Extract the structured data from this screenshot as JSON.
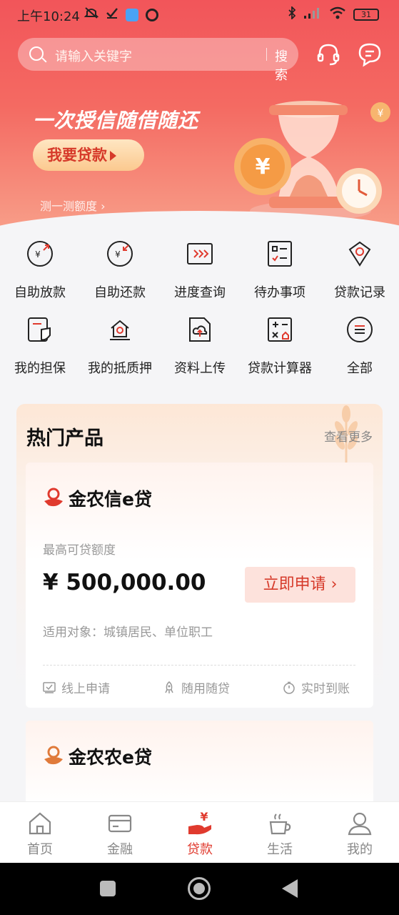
{
  "status_bar": {
    "time": "上午10:24",
    "battery": "31"
  },
  "search": {
    "placeholder": "请输入关键字",
    "button": "搜索"
  },
  "banner": {
    "title": "一次授信随借随还",
    "button": "我要贷款",
    "sub_link": "测一测额度 ›"
  },
  "features": [
    {
      "label": "自助放款",
      "icon": "self-lend-icon"
    },
    {
      "label": "自助还款",
      "icon": "self-repay-icon"
    },
    {
      "label": "进度查询",
      "icon": "progress-icon"
    },
    {
      "label": "待办事项",
      "icon": "todo-icon"
    },
    {
      "label": "贷款记录",
      "icon": "loan-record-icon"
    },
    {
      "label": "我的担保",
      "icon": "guarantee-icon"
    },
    {
      "label": "我的抵质押",
      "icon": "mortgage-icon"
    },
    {
      "label": "资料上传",
      "icon": "upload-icon"
    },
    {
      "label": "贷款计算器",
      "icon": "calculator-icon"
    },
    {
      "label": "全部",
      "icon": "all-menu-icon"
    }
  ],
  "hot_products": {
    "title": "热门产品",
    "more": "查看更多",
    "cards": [
      {
        "name": "金农信e贷",
        "limit_label": "最高可贷额度",
        "amount": "¥ 500,000.00",
        "apply": "立即申请 ›",
        "target": "适用对象：城镇居民、单位职工",
        "features": [
          "线上申请",
          "随用随贷",
          "实时到账"
        ]
      },
      {
        "name": "金农农e贷"
      }
    ]
  },
  "tabbar": [
    {
      "label": "首页",
      "icon": "home-icon"
    },
    {
      "label": "金融",
      "icon": "card-icon"
    },
    {
      "label": "贷款",
      "icon": "loan-icon",
      "active": true
    },
    {
      "label": "生活",
      "icon": "coffee-icon"
    },
    {
      "label": "我的",
      "icon": "user-icon"
    }
  ],
  "colors": {
    "primary": "#e03a2e",
    "header_top": "#f2555a",
    "apply_bg": "#fde2dc"
  }
}
